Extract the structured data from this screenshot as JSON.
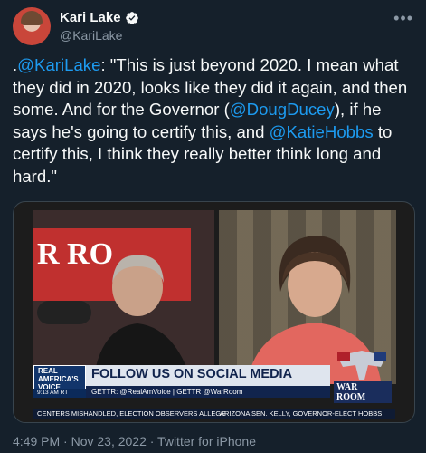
{
  "author": {
    "name": "Kari Lake",
    "handle": "@KariLake"
  },
  "more_label": "•••",
  "tweet": {
    "parts": [
      {
        "text": ".",
        "mention": false
      },
      {
        "text": "@KariLake",
        "mention": true
      },
      {
        "text": ": \"This is just beyond 2020. I mean what they did in 2020, looks like they did it again, and then some. And for the Governor (",
        "mention": false
      },
      {
        "text": "@DougDucey",
        "mention": true
      },
      {
        "text": "), if he says he's going to certify this, and ",
        "mention": false
      },
      {
        "text": "@KatieHobbs",
        "mention": true
      },
      {
        "text": " to certify this, I think they really better think long and hard.\"",
        "mention": false
      }
    ]
  },
  "video": {
    "left_sign": "R RO",
    "network_logo": [
      "REAL",
      "AMERICA'S",
      "VOICE"
    ],
    "timestamp": "9:13 AM RT",
    "banner_title": "FOLLOW US ON SOCIAL MEDIA",
    "banner_sub": "GETTR: @RealAmVoice | GETTR @WarRoom",
    "warroom_label": "WAR ROOM",
    "ticker_left": "CENTERS MISHANDLED, ELECTION OBSERVERS ALLEGE",
    "ticker_right": "ARIZONA SEN. KELLY, GOVERNOR-ELECT HOBBS"
  },
  "meta": "4:49 PM · Nov 23, 2022 · Twitter for iPhone",
  "colors": {
    "background": "#15202b",
    "mention": "#1d9bf0",
    "verified": "#1d9bf0",
    "muted": "#8b98a5"
  }
}
